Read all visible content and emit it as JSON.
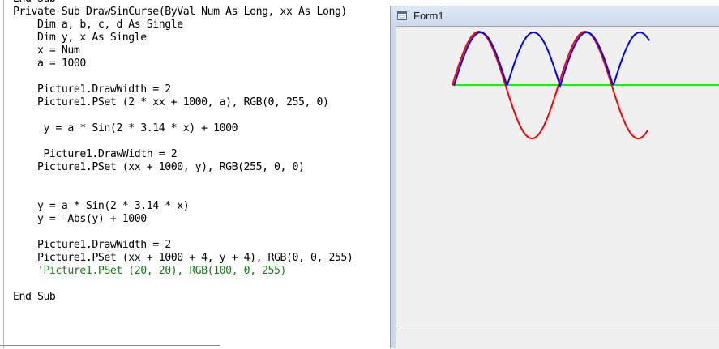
{
  "editor": {
    "lines": [
      "End Sub",
      "Private Sub DrawSinCurse(ByVal Num As Long, xx As Long)",
      "    Dim a, b, c, d As Single",
      "    Dim y, x As Single",
      "    x = Num",
      "    a = 1000",
      "",
      "    Picture1.DrawWidth = 2",
      "    Picture1.PSet (2 * xx + 1000, a), RGB(0, 255, 0)",
      "",
      "     y = a * Sin(2 * 3.14 * x) + 1000",
      "",
      "     Picture1.DrawWidth = 2",
      "    Picture1.PSet (xx + 1000, y), RGB(255, 0, 0)",
      "",
      "",
      "    y = a * Sin(2 * 3.14 * x)",
      "    y = -Abs(y) + 1000",
      "",
      "    Picture1.DrawWidth = 2",
      "    Picture1.PSet (xx + 1000 + 4, y + 4), RGB(0, 0, 255)",
      "    'Picture1.PSet (20, 20), RGB(100, 0, 255)",
      "",
      "End Sub"
    ],
    "comment_line_index": 21
  },
  "form": {
    "title": "Form1",
    "icon": "form-window-icon"
  },
  "plot": {
    "baseline_color": "#00ff00",
    "sine_color": "#ff0000",
    "abs_sine_color": "#0000ff"
  }
}
